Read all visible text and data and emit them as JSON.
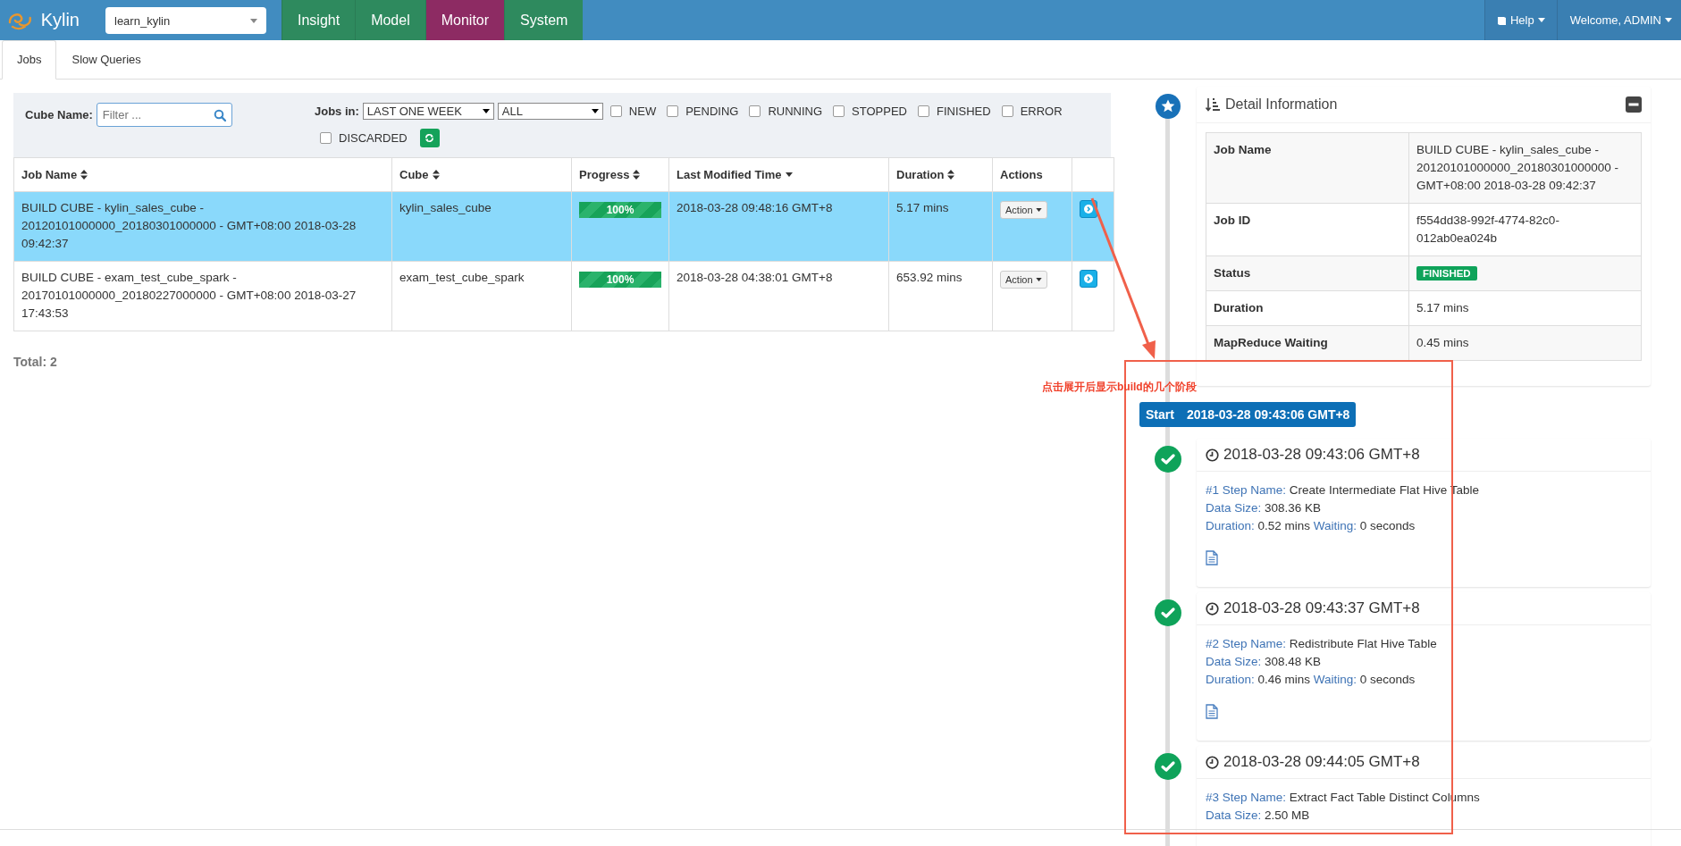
{
  "navbar": {
    "brand": "Kylin",
    "project": "learn_kylin",
    "items": [
      {
        "label": "Insight",
        "selected": false
      },
      {
        "label": "Model",
        "selected": false
      },
      {
        "label": "Monitor",
        "selected": true
      },
      {
        "label": "System",
        "selected": false
      }
    ],
    "help": "Help",
    "user": "Welcome, ADMIN"
  },
  "tabs": [
    {
      "label": "Jobs",
      "selected": true
    },
    {
      "label": "Slow Queries",
      "selected": false
    }
  ],
  "filters": {
    "cube_label": "Cube Name:",
    "search": {
      "placeholder": "Filter ..."
    },
    "jobs_in_label": "Jobs in:",
    "period": "LAST ONE WEEK",
    "scope": "ALL",
    "statuses": [
      {
        "label": "NEW",
        "checked": false
      },
      {
        "label": "PENDING",
        "checked": false
      },
      {
        "label": "RUNNING",
        "checked": false
      },
      {
        "label": "STOPPED",
        "checked": false
      },
      {
        "label": "FINISHED",
        "checked": false
      },
      {
        "label": "ERROR",
        "checked": false
      },
      {
        "label": "DISCARDED",
        "checked": false
      }
    ]
  },
  "table": {
    "columns": [
      {
        "label": "Job Name",
        "sortable": true,
        "sorted": false
      },
      {
        "label": "Cube",
        "sortable": true,
        "sorted": false
      },
      {
        "label": "Progress",
        "sortable": true,
        "sorted": false
      },
      {
        "label": "Last Modified Time",
        "sortable": true,
        "sorted": true
      },
      {
        "label": "Duration",
        "sortable": true,
        "sorted": false
      },
      {
        "label": "Actions",
        "sortable": false,
        "sorted": false
      }
    ],
    "rows": [
      {
        "job_name": "BUILD CUBE - kylin_sales_cube - 20120101000000_20180301000000 - GMT+08:00 2018-03-28 09:42:37",
        "cube": "kylin_sales_cube",
        "progress": "100%",
        "level": 1,
        "last_modified": "2018-03-28 09:48:16 GMT+8",
        "duration": "5.17 mins",
        "action": "Action",
        "selected": true
      },
      {
        "job_name": "BUILD CUBE - exam_test_cube_spark - 20170101000000_20180227000000 - GMT+08:00 2018-03-27 17:43:53",
        "cube": "exam_test_cube_spark",
        "progress": "100%",
        "level": 1,
        "last_modified": "2018-03-28 04:38:01 GMT+8",
        "duration": "653.92 mins",
        "action": "Action",
        "selected": false
      }
    ]
  },
  "total": "Total: 2",
  "detail": {
    "title": "Detail Information",
    "fields": [
      {
        "label": "Job Name",
        "value": "BUILD CUBE - kylin_sales_cube - 20120101000000_20180301000000 - GMT+08:00 2018-03-28 09:42:37",
        "kind": "text"
      },
      {
        "label": "Job ID",
        "value": "f554dd38-992f-4774-82c0-012ab0ea024b",
        "kind": "text"
      },
      {
        "label": "Status",
        "value": "FINISHED",
        "kind": "badge"
      },
      {
        "label": "Duration",
        "value": "5.17 mins",
        "kind": "text"
      },
      {
        "label": "MapReduce Waiting",
        "value": "0.45 mins",
        "kind": "text"
      }
    ]
  },
  "timeline": {
    "start_label": "Start",
    "start_time": "2018-03-28 09:43:06 GMT+8",
    "steps": [
      {
        "time": "2018-03-28 09:43:06 GMT+8",
        "step_label": "#1 Step Name:",
        "step_name": "Create Intermediate Flat Hive Table",
        "size_label": "Data Size:",
        "size": "308.36 KB",
        "duration_label": "Duration:",
        "duration": "0.52 mins",
        "waiting_label": "Waiting:",
        "waiting": "0 seconds",
        "has_log": true
      },
      {
        "time": "2018-03-28 09:43:37 GMT+8",
        "step_label": "#2 Step Name:",
        "step_name": "Redistribute Flat Hive Table",
        "size_label": "Data Size:",
        "size": "308.48 KB",
        "duration_label": "Duration:",
        "duration": "0.46 mins",
        "waiting_label": "Waiting:",
        "waiting": "0 seconds",
        "has_log": true
      },
      {
        "time": "2018-03-28 09:44:05 GMT+8",
        "step_label": "#3 Step Name:",
        "step_name": "Extract Fact Table Distinct Columns",
        "size_label": "Data Size:",
        "size": "2.50 MB",
        "has_log": false
      }
    ]
  },
  "annotation": {
    "note": "点击展开后显示build的几个阶段"
  }
}
